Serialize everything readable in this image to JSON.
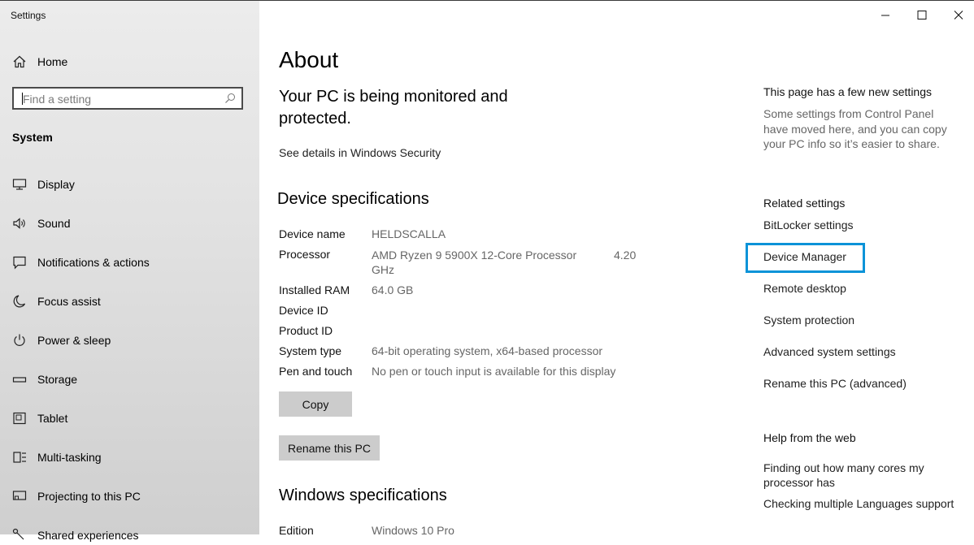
{
  "window": {
    "title": "Settings"
  },
  "sidebar": {
    "home_label": "Home",
    "search_placeholder": "Find a setting",
    "section_label": "System",
    "items": [
      {
        "label": "Display",
        "icon": "monitor-icon"
      },
      {
        "label": "Sound",
        "icon": "speaker-icon"
      },
      {
        "label": "Notifications & actions",
        "icon": "notification-icon"
      },
      {
        "label": "Focus assist",
        "icon": "moon-icon"
      },
      {
        "label": "Power & sleep",
        "icon": "power-icon"
      },
      {
        "label": "Storage",
        "icon": "storage-icon"
      },
      {
        "label": "Tablet",
        "icon": "tablet-icon"
      },
      {
        "label": "Multi-tasking",
        "icon": "multitasking-icon"
      },
      {
        "label": "Projecting to this PC",
        "icon": "projecting-icon"
      },
      {
        "label": "Shared experiences",
        "icon": "shared-icon"
      }
    ]
  },
  "main": {
    "title": "About",
    "protection_text": "Your PC is being monitored and protected.",
    "security_link": "See details in Windows Security",
    "device_spec_title": "Device specifications",
    "specs": [
      {
        "key": "Device name",
        "value": "HELDSCALLA"
      },
      {
        "key": "Processor",
        "value": "AMD Ryzen 9 5900X 12-Core Processor",
        "value_extra": "4.20",
        "value_line2": "GHz"
      },
      {
        "key": "Installed RAM",
        "value": "64.0 GB"
      },
      {
        "key": "Device ID",
        "value": ""
      },
      {
        "key": "Product ID",
        "value": ""
      },
      {
        "key": "System type",
        "value": "64-bit operating system, x64-based processor"
      },
      {
        "key": "Pen and touch",
        "value": "No pen or touch input is available for this display"
      }
    ],
    "copy_label": "Copy",
    "rename_label": "Rename this PC",
    "windows_spec_title": "Windows specifications",
    "edition_key": "Edition",
    "edition_value": "Windows 10 Pro"
  },
  "right": {
    "new_settings_title": "This page has a few new settings",
    "new_settings_text": "Some settings from Control Panel have moved here, and you can copy your PC info so it’s easier to share.",
    "related_title": "Related settings",
    "related_links": [
      "BitLocker settings",
      "Device Manager",
      "Remote desktop",
      "System protection",
      "Advanced system settings",
      "Rename this PC (advanced)"
    ],
    "help_title": "Help from the web",
    "help_links": [
      "Finding out how many cores my processor has",
      "Checking multiple Languages support"
    ]
  },
  "colors": {
    "highlight": "#0a93d8",
    "button_bg": "#cccccc",
    "sidebar_bg": "#e6e6e6"
  }
}
